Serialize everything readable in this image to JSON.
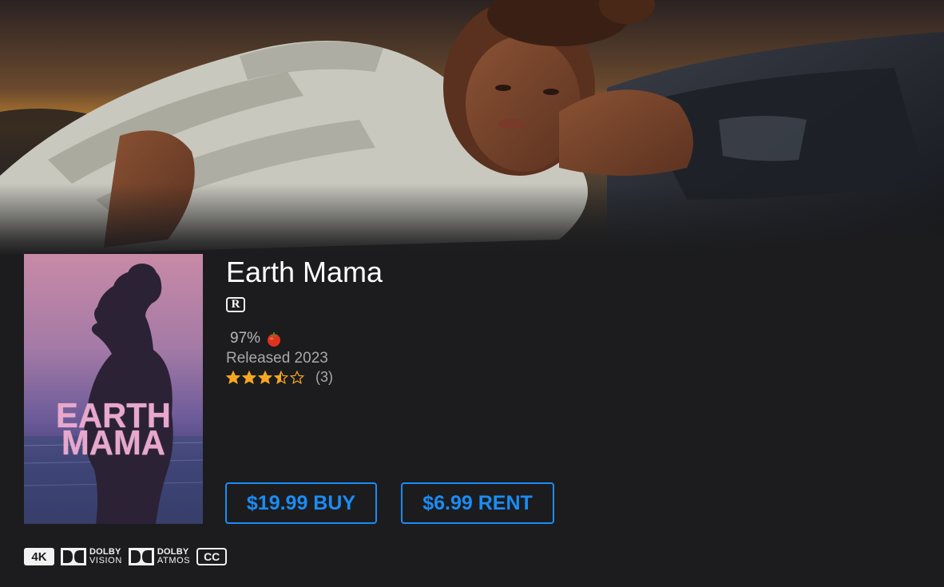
{
  "movie": {
    "title": "Earth Mama",
    "mpaa_rating": "R",
    "tomatometer": "97%",
    "released": "Released 2023",
    "star_rating": 3.5,
    "star_max": 5,
    "rating_count": "(3)"
  },
  "poster": {
    "title_line1": "EARTH",
    "title_line2": "MAMA"
  },
  "actions": {
    "buy_label": "$19.99 BUY",
    "rent_label": "$6.99 RENT"
  },
  "badges": {
    "resolution": "4K",
    "dolby_vision_top": "DOLBY",
    "dolby_vision_bottom": "VISION",
    "dolby_atmos_top": "DOLBY",
    "dolby_atmos_bottom": "ATMOS",
    "cc": "CC"
  },
  "colors": {
    "background": "#1c1c1e",
    "accent": "#1a8cf5",
    "star": "#f5a623",
    "poster_title": "#e7a8cc"
  }
}
